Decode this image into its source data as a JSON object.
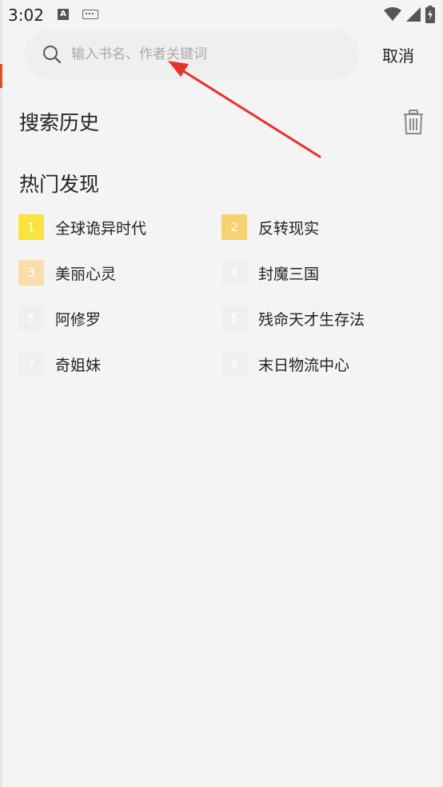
{
  "status_bar": {
    "time": "3:02"
  },
  "search": {
    "placeholder": "输入书名、作者关键词",
    "value": "",
    "cancel_label": "取消"
  },
  "history": {
    "title": "搜索历史"
  },
  "hot": {
    "title": "热门发现",
    "items": [
      {
        "rank": "1",
        "title": "全球诡异时代",
        "badge_color": "#f9e33c"
      },
      {
        "rank": "2",
        "title": "反转现实",
        "badge_color": "#f6d26e"
      },
      {
        "rank": "3",
        "title": "美丽心灵",
        "badge_color": "#f8deaa"
      },
      {
        "rank": "4",
        "title": "封魔三国",
        "badge_color": "#efefef"
      },
      {
        "rank": "5",
        "title": "阿修罗",
        "badge_color": "#efefef"
      },
      {
        "rank": "6",
        "title": "残命天才生存法",
        "badge_color": "#efefef"
      },
      {
        "rank": "7",
        "title": "奇姐妹",
        "badge_color": "#efefef"
      },
      {
        "rank": "8",
        "title": "末日物流中心",
        "badge_color": "#efefef"
      }
    ]
  },
  "colors": {
    "background": "#f4f4f4",
    "annotation_arrow": "#e8322c",
    "text": "#222222"
  },
  "icons": {
    "search": "search-icon",
    "trash": "trash-icon",
    "wifi": "wifi-icon",
    "signal": "signal-icon",
    "battery": "battery-icon"
  }
}
